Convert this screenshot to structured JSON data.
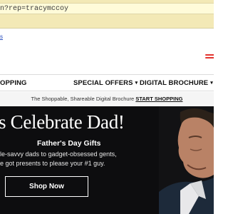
{
  "browser": {
    "address_text": "n?rep=tracymccoy",
    "bookmark_text": "s"
  },
  "nav": {
    "items": [
      {
        "label": "OPPING",
        "caret": ""
      },
      {
        "label": "SPECIAL OFFERS",
        "caret": "▾"
      },
      {
        "label": "DIGITAL BROCHURE",
        "caret": "▾"
      }
    ]
  },
  "promo": {
    "text": "The Shoppable, Shareable Digital Brochure",
    "link": "START SHOPPING"
  },
  "hero": {
    "title": "s Celebrate Dad!",
    "subtitle": "Father's Day Gifts",
    "description_line1": "le-savvy dads to gadget-obsessed gents,",
    "description_line2": "e got presents to please your #1 guy.",
    "button_label": "Shop Now"
  },
  "colors": {
    "address_bar": "#f3e9b6",
    "hero_bg": "#0d0d0f",
    "brand_accent": "#e3342f"
  }
}
